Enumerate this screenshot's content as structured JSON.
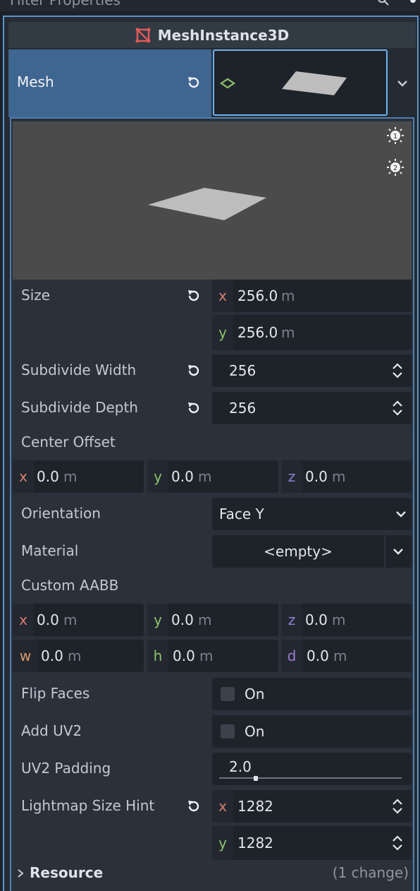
{
  "top_bar": {
    "filter_text": "Filter Properties"
  },
  "node": {
    "title": "MeshInstance3D",
    "icon_color": "#e05a5a"
  },
  "mesh": {
    "label": "Mesh"
  },
  "properties": {
    "size": {
      "label": "Size",
      "x": "256.0",
      "y": "256.0",
      "unit": "m"
    },
    "subdivide_width": {
      "label": "Subdivide Width",
      "value": "256"
    },
    "subdivide_depth": {
      "label": "Subdivide Depth",
      "value": "256"
    },
    "center_offset": {
      "label": "Center Offset",
      "x": "0.0",
      "y": "0.0",
      "z": "0.0",
      "unit": "m"
    },
    "orientation": {
      "label": "Orientation",
      "value": "Face Y"
    },
    "material": {
      "label": "Material",
      "value": "<empty>"
    },
    "custom_aabb": {
      "label": "Custom AABB",
      "x": "0.0",
      "y": "0.0",
      "z": "0.0",
      "w": "0.0",
      "h": "0.0",
      "d": "0.0",
      "unit": "m"
    },
    "flip_faces": {
      "label": "Flip Faces",
      "checkbox_label": "On",
      "checked": false
    },
    "add_uv2": {
      "label": "Add UV2",
      "checkbox_label": "On",
      "checked": false
    },
    "uv2_padding": {
      "label": "UV2 Padding",
      "value": "2.0",
      "slider_fraction": 0.2
    },
    "lightmap_size_hint": {
      "label": "Lightmap Size Hint",
      "x": "1282",
      "y": "1282"
    }
  },
  "resource_section": {
    "label": "Resource",
    "changes": "(1 change)"
  },
  "axis_letters": {
    "x": "x",
    "y": "y",
    "z": "z",
    "w": "w",
    "h": "h",
    "d": "d"
  },
  "colors": {
    "accent": "#5c95c9",
    "selected_row": "#3f6691",
    "field_bg": "#1e232a",
    "panel_bg": "#2a313b"
  }
}
